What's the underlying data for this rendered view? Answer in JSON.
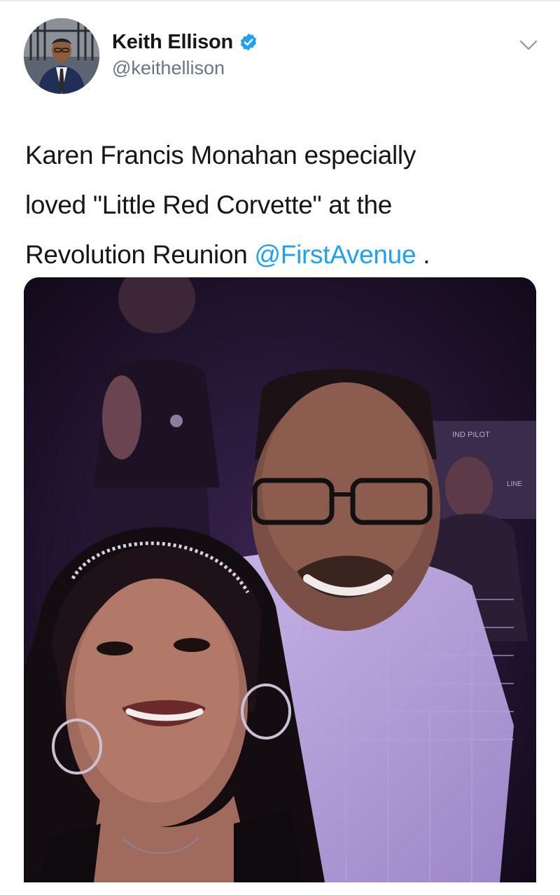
{
  "tweet": {
    "author": {
      "display_name": "Keith Ellison",
      "handle": "@keithellison",
      "verified": true,
      "avatar_icon": "profile-photo"
    },
    "text": {
      "line1": "Karen Francis Monahan especially",
      "line2": "loved \"Little Red Corvette\" at the",
      "line3_prefix": "Revolution Reunion ",
      "mention": "@FirstAvenue",
      "line3_suffix": " ."
    },
    "menu_icon": "chevron-down-icon",
    "media": {
      "type": "photo",
      "background_sign_1": "IND PILOT",
      "background_sign_2": "LINE"
    }
  },
  "colors": {
    "link": "#1da1f2",
    "verified_badge": "#1da1f2",
    "text_primary": "#14171a",
    "text_secondary": "#657786"
  }
}
